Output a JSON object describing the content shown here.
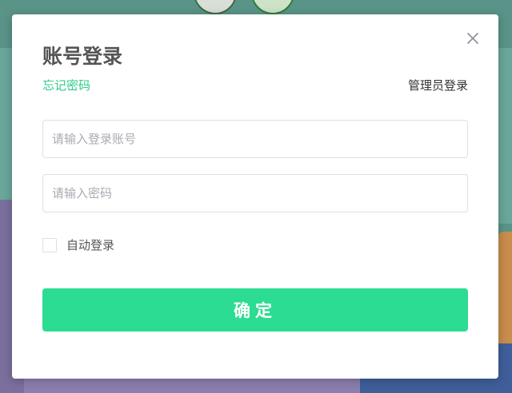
{
  "dialog": {
    "title": "账号登录",
    "forgot_password": "忘记密码",
    "admin_login": "管理员登录",
    "close_icon": "close-icon"
  },
  "form": {
    "account": {
      "value": "",
      "placeholder": "请输入登录账号"
    },
    "password": {
      "value": "",
      "placeholder": "请输入密码"
    },
    "remember": {
      "label": "自动登录",
      "checked": false
    },
    "submit_label": "确定"
  },
  "colors": {
    "accent": "#2cdc92",
    "link": "#2ecb8a",
    "title": "#555555"
  }
}
